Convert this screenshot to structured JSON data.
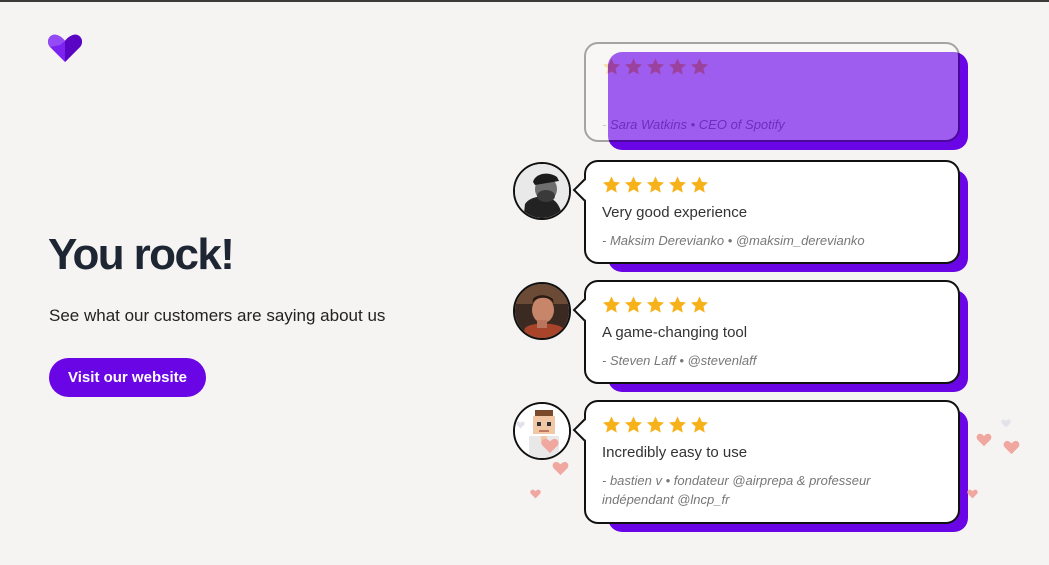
{
  "brand": {
    "logo_icon": "heart-logo-icon",
    "accent": "#6a06e6"
  },
  "hero": {
    "headline": "You rock!",
    "subtitle": "See what our customers are saying about us",
    "cta_label": "Visit our website"
  },
  "reviews": [
    {
      "stars": 5,
      "title": "",
      "author": "- Sara Watkins • CEO of Spotify",
      "faded": true
    },
    {
      "stars": 5,
      "title": "Very good experience",
      "author": "- Maksim Derevianko • @maksim_derevianko",
      "avatar": "avatar-bw-cap"
    },
    {
      "stars": 5,
      "title": "A game-changing tool",
      "author": "- Steven Laff • @stevenlaff",
      "avatar": "avatar-photo"
    },
    {
      "stars": 5,
      "title": "Incredibly easy to use",
      "author": "- bastien v • fondateur @airprepa & professeur indépendant @lncp_fr",
      "avatar": "avatar-pixel"
    }
  ],
  "colors": {
    "star": "#f7b21a",
    "heart_pink": "#f0a7a0",
    "background": "#f5f4f2"
  }
}
